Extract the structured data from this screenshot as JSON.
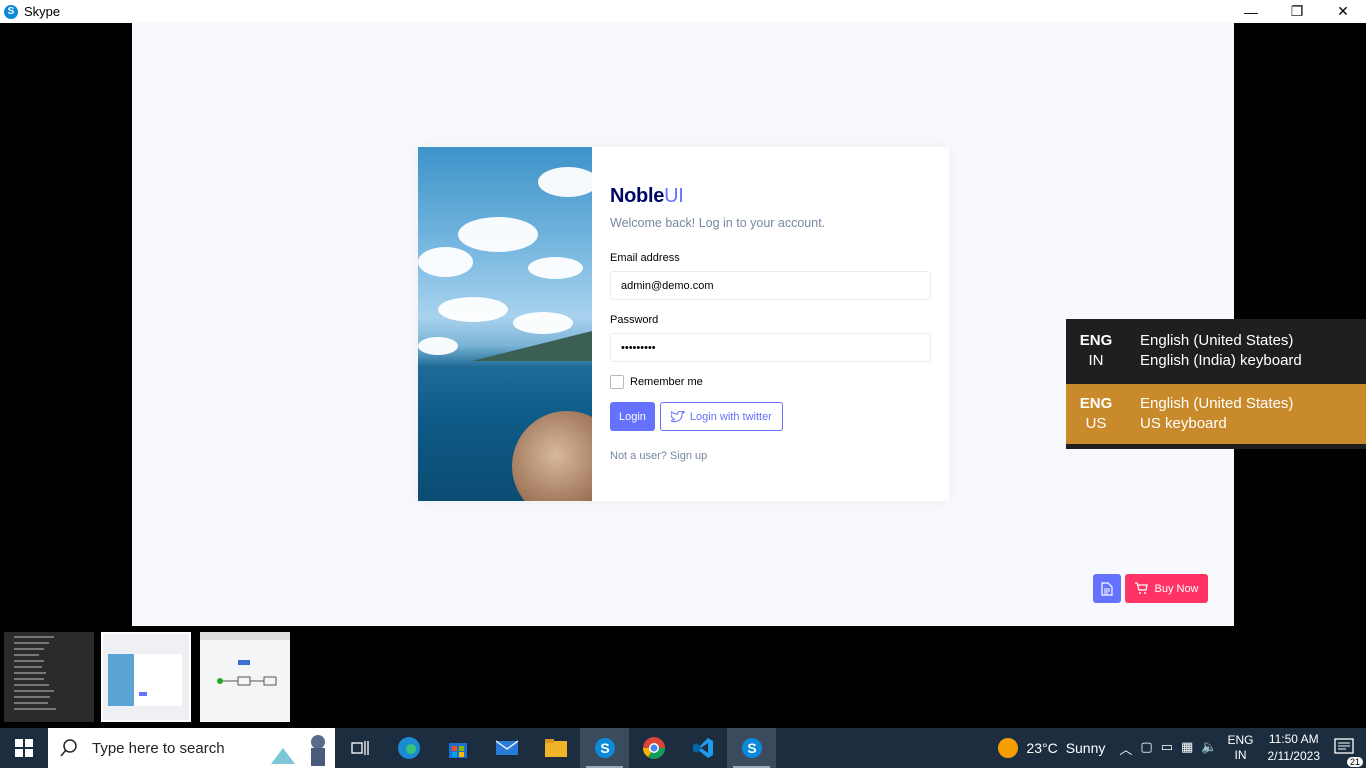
{
  "window": {
    "title": "Skype",
    "app_icon_letter": "S",
    "minimize": "—",
    "restore": "❐",
    "close": "✕"
  },
  "login": {
    "logo_main": "Noble",
    "logo_light": "UI",
    "welcome": "Welcome back! Log in to your account.",
    "email_label": "Email address",
    "email_value": "admin@demo.com",
    "password_label": "Password",
    "password_value": "•••••••••",
    "remember_label": "Remember me",
    "login_button": "Login",
    "twitter_button": "Login with twitter",
    "signup_text": "Not a user? Sign up"
  },
  "floating": {
    "buy_now": "Buy Now"
  },
  "language_switcher": {
    "items": [
      {
        "code1": "ENG",
        "code2": "IN",
        "line1": "English (United States)",
        "line2": "English (India) keyboard",
        "selected": false
      },
      {
        "code1": "ENG",
        "code2": "US",
        "line1": "English (United States)",
        "line2": "US keyboard",
        "selected": true
      }
    ]
  },
  "taskbar": {
    "search_placeholder": "Type here to search",
    "weather": {
      "temp": "23°C",
      "condition": "Sunny"
    },
    "lang": {
      "line1": "ENG",
      "line2": "IN"
    },
    "clock": {
      "time": "11:50 AM",
      "date": "2/11/2023"
    },
    "notification_count": "21",
    "apps": [
      "task-view",
      "edge",
      "store",
      "mail",
      "file-explorer",
      "skype",
      "chrome",
      "vscode",
      "skype"
    ]
  },
  "colors": {
    "accent": "#6571ff",
    "brand_dark": "#000864",
    "buy_now": "#ff3366",
    "lang_selected": "#c98a2c",
    "taskbar": "#1c2d40"
  }
}
